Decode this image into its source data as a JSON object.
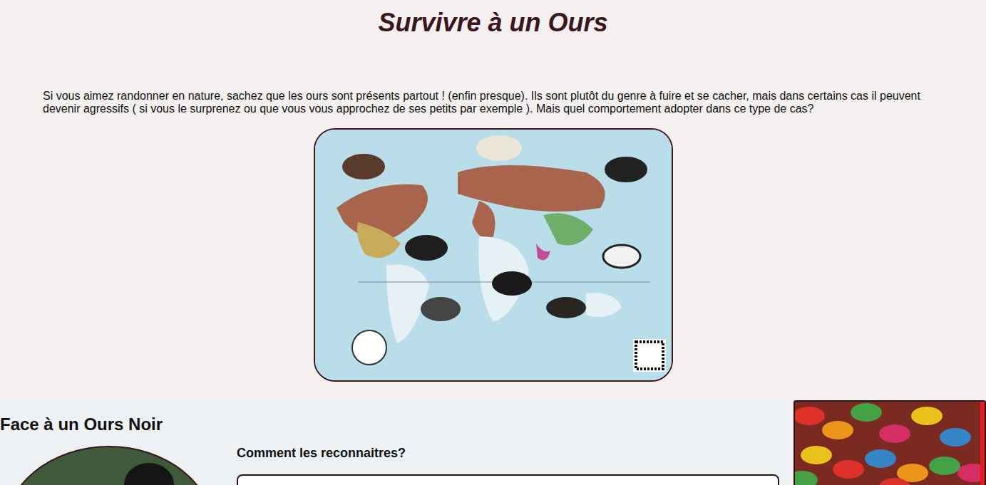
{
  "page": {
    "title": "Survivre à un Ours",
    "intro": "Si vous aimez randonner en nature, sachez que les ours sont présents partout ! (enfin presque). Ils sont plutôt du genre à fuire et se cacher, mais dans certains cas il peuvent devenir agressifs ( si vous le surprenez ou que vous vous approchez de ses petits par exemple ). Mais quel comportement adopter dans ce type de cas?"
  },
  "section": {
    "heading": "Face à un Ours Noir",
    "subheading": "Comment les reconnaitres?"
  }
}
